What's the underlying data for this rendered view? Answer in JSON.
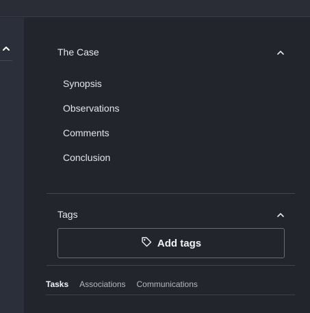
{
  "case_section": {
    "title": "The Case",
    "items": [
      {
        "label": "Synopsis"
      },
      {
        "label": "Observations"
      },
      {
        "label": "Comments"
      },
      {
        "label": "Conclusion"
      }
    ]
  },
  "tags_section": {
    "title": "Tags",
    "add_label": "Add tags"
  },
  "tabs": [
    {
      "label": "Tasks",
      "active": true
    },
    {
      "label": "Associations",
      "active": false
    },
    {
      "label": "Communications",
      "active": false
    }
  ],
  "icons": {
    "collapse": "chevron-up-icon",
    "tag": "tag-icon"
  },
  "colors": {
    "panel_bg": "#23252d",
    "rail_bg": "#2b2f3a",
    "text": "#e8e9ec",
    "border": "#6a6d76"
  }
}
